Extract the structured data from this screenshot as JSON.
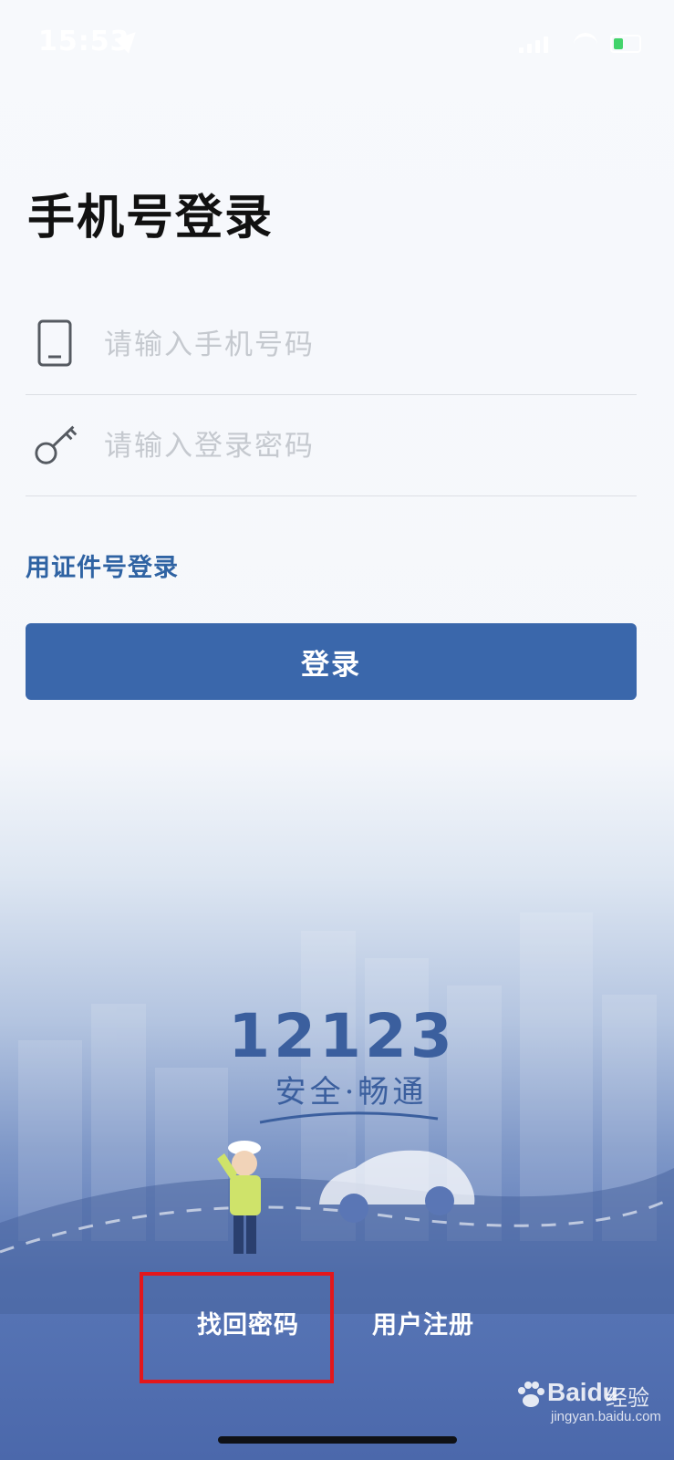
{
  "status_bar": {
    "time": "15:53"
  },
  "page": {
    "title": "手机号登录"
  },
  "form": {
    "phone": {
      "placeholder": "请输入手机号码",
      "value": ""
    },
    "password": {
      "placeholder": "请输入登录密码",
      "value": ""
    },
    "alt_login_label": "用证件号登录",
    "login_button_label": "登录"
  },
  "brand": {
    "number": "12123",
    "slogan": "安全·畅通"
  },
  "bottom_links": {
    "forgot_password": "找回密码",
    "register": "用户注册"
  },
  "watermark": {
    "logo": "Baidu",
    "label": "经验",
    "url": "jingyan.baidu.com"
  },
  "colors": {
    "primary": "#3a67ab",
    "link": "#2f63a3",
    "highlight_box": "#e3171b",
    "battery": "#43d36b"
  }
}
